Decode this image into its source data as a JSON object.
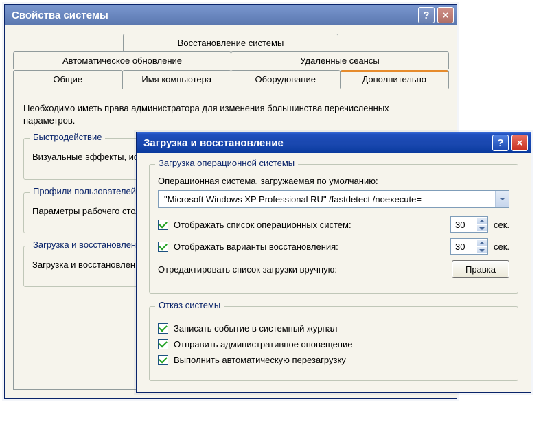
{
  "parent": {
    "title": "Свойства системы",
    "tabs": {
      "row1": [
        "Восстановление системы"
      ],
      "row2": [
        "Автоматическое обновление",
        "Удаленные сеансы"
      ],
      "row3": [
        "Общие",
        "Имя компьютера",
        "Оборудование",
        "Дополнительно"
      ]
    },
    "intro": "Необходимо иметь права администратора для изменения большинства перечисленных параметров.",
    "groups": {
      "perf": {
        "title": "Быстродействие",
        "text": "Визуальные эффекты, использование процессора, оперативной и виртуальной памяти"
      },
      "profiles": {
        "title": "Профили пользователей",
        "text": "Параметры рабочего стола, относящиеся ко входу в систему"
      },
      "startup": {
        "title": "Загрузка и восстановление",
        "text": "Загрузка и восстановление системы, отладочная информация"
      }
    }
  },
  "child": {
    "title": "Загрузка и восстановление",
    "os_group": {
      "title": "Загрузка операционной системы",
      "default_label": "Операционная система, загружаемая по умолчанию:",
      "default_value": "\"Microsoft Windows XP Professional RU\" /fastdetect  /noexecute=",
      "show_os_list_label": "Отображать список операционных систем:",
      "show_os_list_value": "30",
      "show_recovery_label": "Отображать варианты восстановления:",
      "show_recovery_value": "30",
      "seconds": "сек.",
      "edit_label": "Отредактировать список загрузки вручную:",
      "edit_button": "Правка"
    },
    "fail_group": {
      "title": "Отказ системы",
      "log_event": "Записать событие в системный журнал",
      "send_alert": "Отправить административное оповещение",
      "auto_restart": "Выполнить автоматическую перезагрузку"
    }
  }
}
